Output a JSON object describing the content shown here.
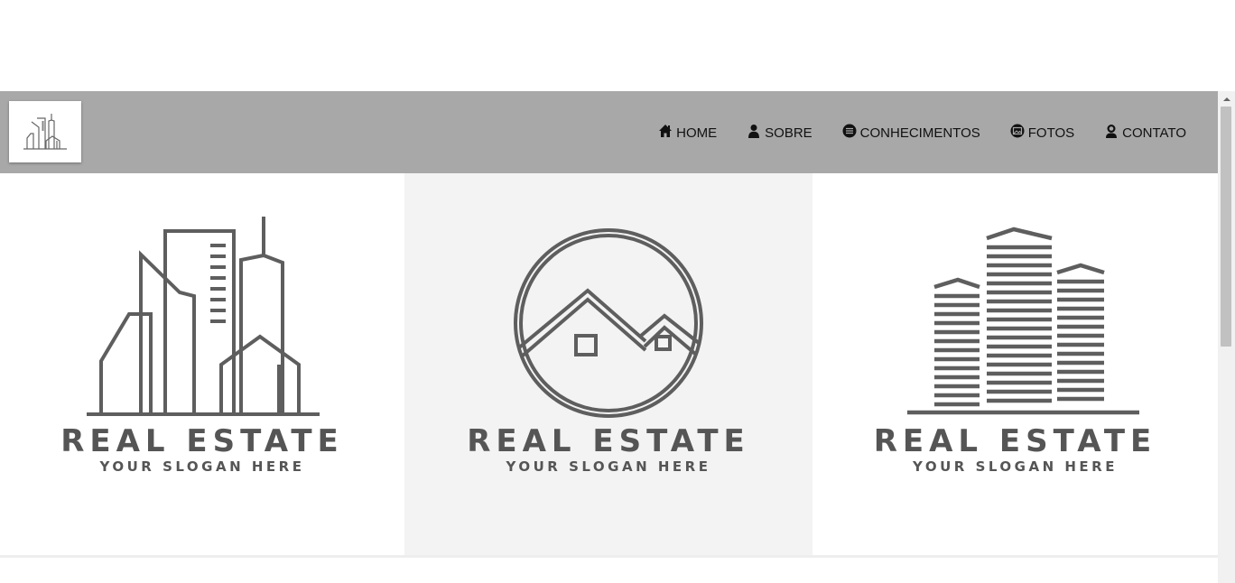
{
  "header": {
    "logo_icon": "city-buildings-logo-icon"
  },
  "nav": {
    "items": [
      {
        "label": "HOME",
        "icon": "home-icon"
      },
      {
        "label": "SOBRE",
        "icon": "user-icon"
      },
      {
        "label": "CONHECIMENTOS",
        "icon": "knowledge-icon"
      },
      {
        "label": "FOTOS",
        "icon": "photo-icon"
      },
      {
        "label": "CONTATO",
        "icon": "contact-icon"
      }
    ]
  },
  "panels": [
    {
      "title": "REAL ESTATE",
      "slogan": "YOUR SLOGAN HERE",
      "art": "city-skyline-logo"
    },
    {
      "title": "REAL ESTATE",
      "slogan": "YOUR SLOGAN HERE",
      "art": "houses-in-circle-logo"
    },
    {
      "title": "REAL ESTATE",
      "slogan": "YOUR SLOGAN HERE",
      "art": "striped-towers-logo"
    }
  ],
  "colors": {
    "navbar_bg": "#a8a8a8",
    "logo_gray": "#555555",
    "middle_panel_bg": "#f3f3f3"
  }
}
